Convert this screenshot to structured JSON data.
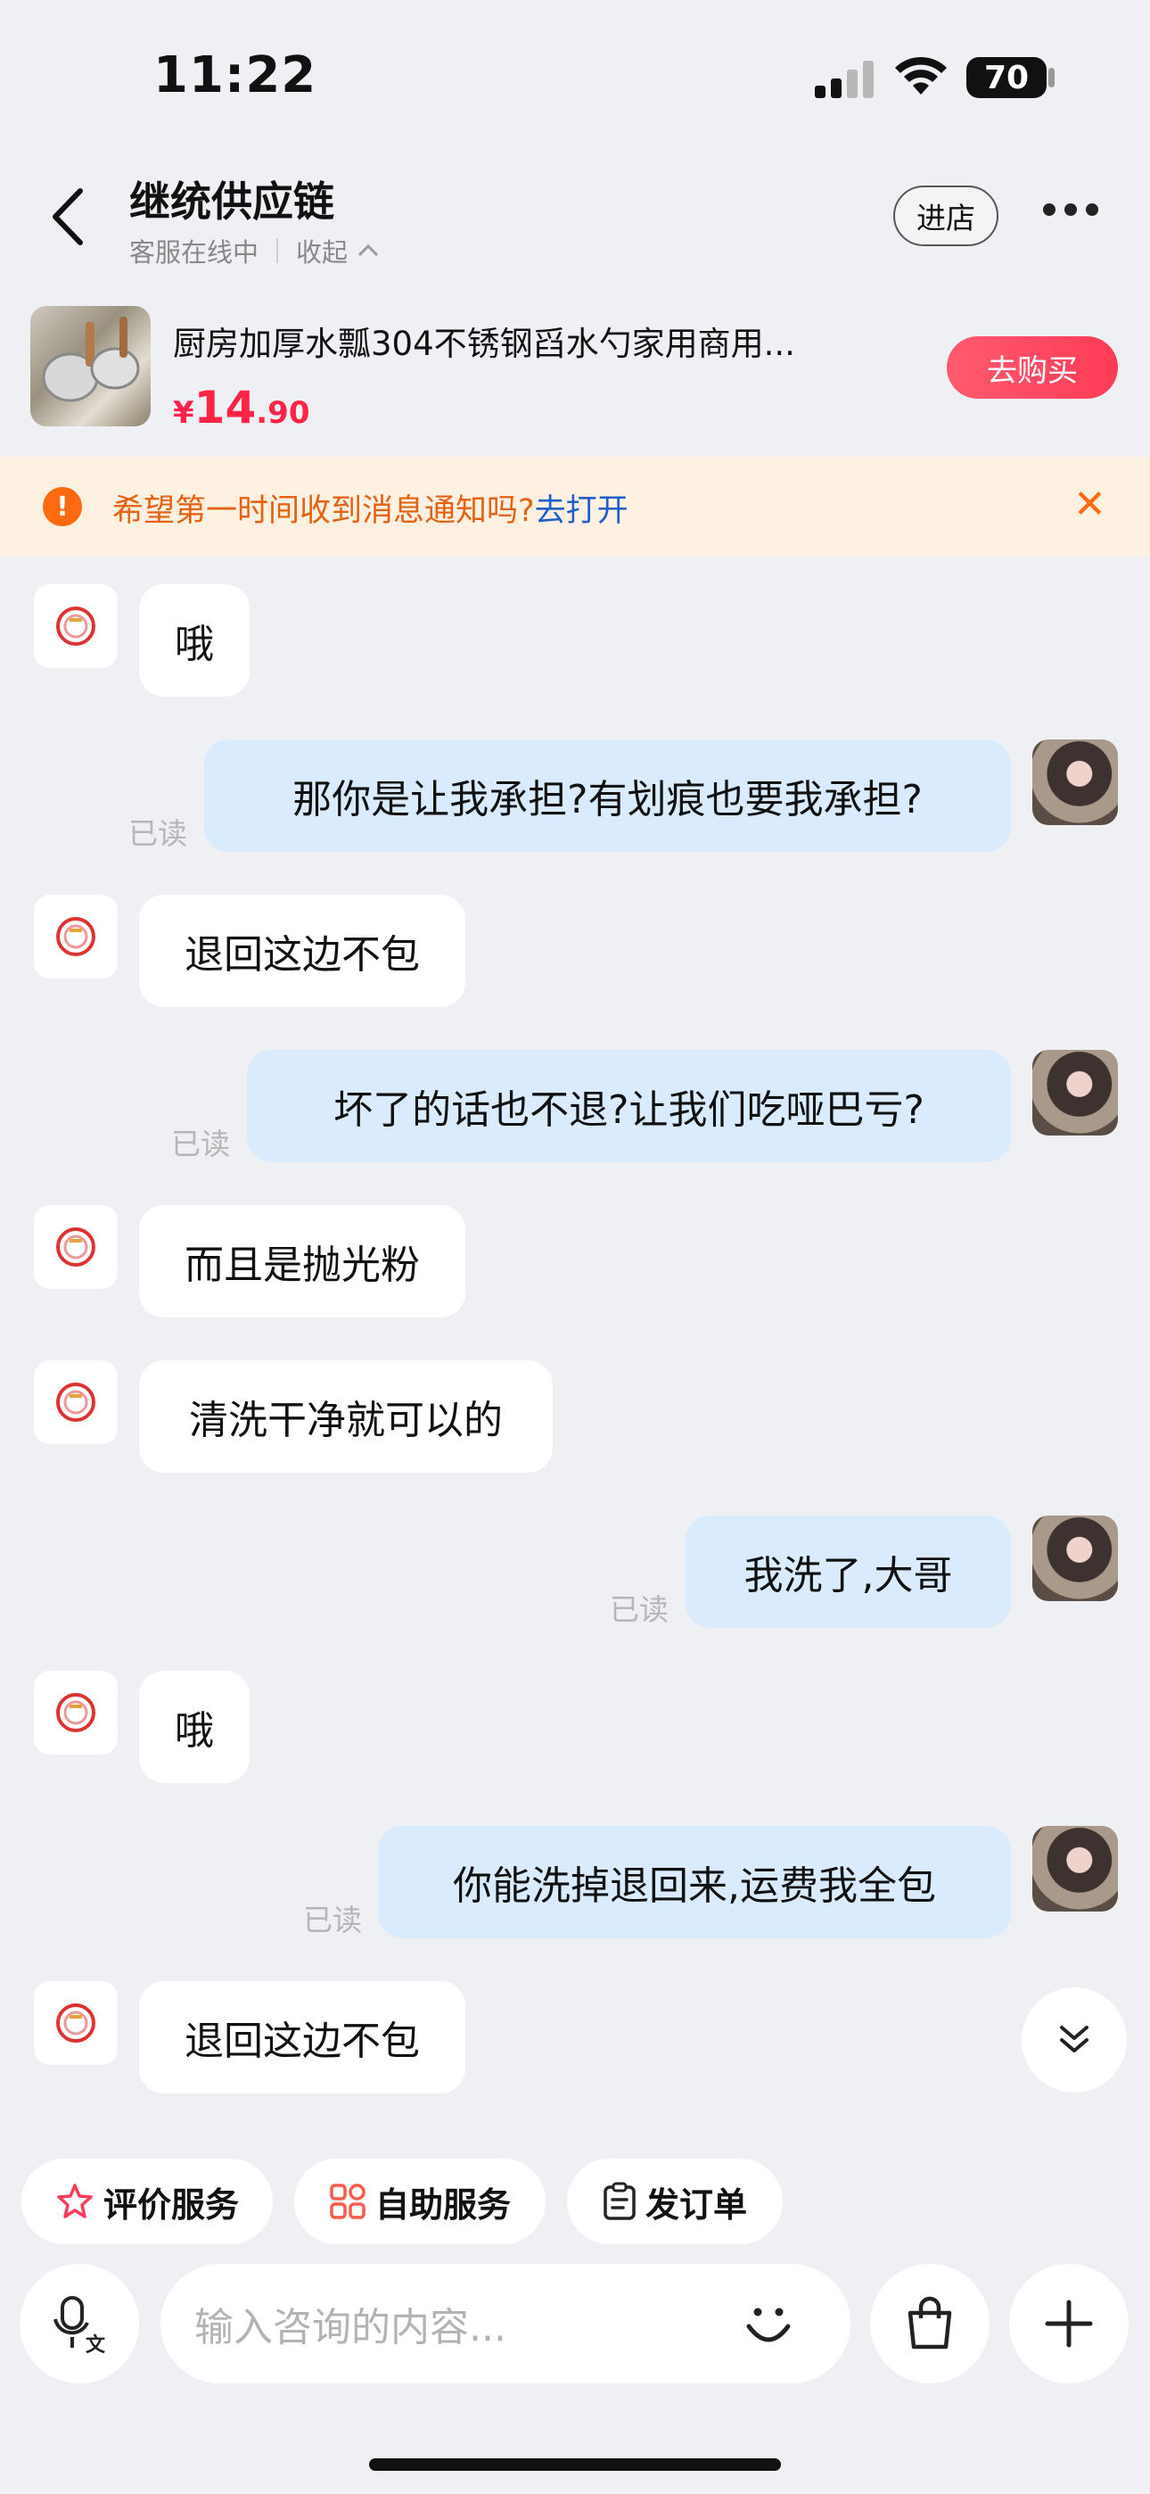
{
  "status_bar": {
    "time": "11:22",
    "battery": "70"
  },
  "header": {
    "shop_name": "继统供应链",
    "status": "客服在线中",
    "collapse_label": "收起",
    "enter_store": "进店"
  },
  "product": {
    "title": "厨房加厚水瓢304不锈钢舀水勺家用商用...",
    "price_symbol": "¥",
    "price_int": "14",
    "price_dec": ".90",
    "buy_label": "去购买"
  },
  "notify": {
    "text": "希望第一时间收到消息通知吗?",
    "link": "去打开"
  },
  "messages": [
    {
      "from": "shop",
      "text": "哦"
    },
    {
      "from": "me",
      "text": "那你是让我承担?有划痕也要我承担?",
      "read": "已读"
    },
    {
      "from": "shop",
      "text": "退回这边不包"
    },
    {
      "from": "me",
      "text": "坏了的话也不退?让我们吃哑巴亏?",
      "read": "已读"
    },
    {
      "from": "shop",
      "text": "而且是抛光粉"
    },
    {
      "from": "shop",
      "text": "清洗干净就可以的"
    },
    {
      "from": "me",
      "text": "我洗了,大哥",
      "read": "已读"
    },
    {
      "from": "shop",
      "text": "哦"
    },
    {
      "from": "me",
      "text": "你能洗掉退回来,运费我全包",
      "read": "已读"
    },
    {
      "from": "shop",
      "text": "退回这边不包"
    }
  ],
  "quick_actions": [
    "评价服务",
    "自助服务",
    "发订单"
  ],
  "input": {
    "placeholder": "输入咨询的内容..."
  },
  "icons": [
    "back-icon",
    "more-icon",
    "alert-icon",
    "close-icon",
    "voice-to-text-icon",
    "emoji-icon",
    "bag-icon",
    "plus-icon",
    "double-chevron-down-icon",
    "star-icon",
    "grid-icon",
    "clipboard-icon"
  ]
}
